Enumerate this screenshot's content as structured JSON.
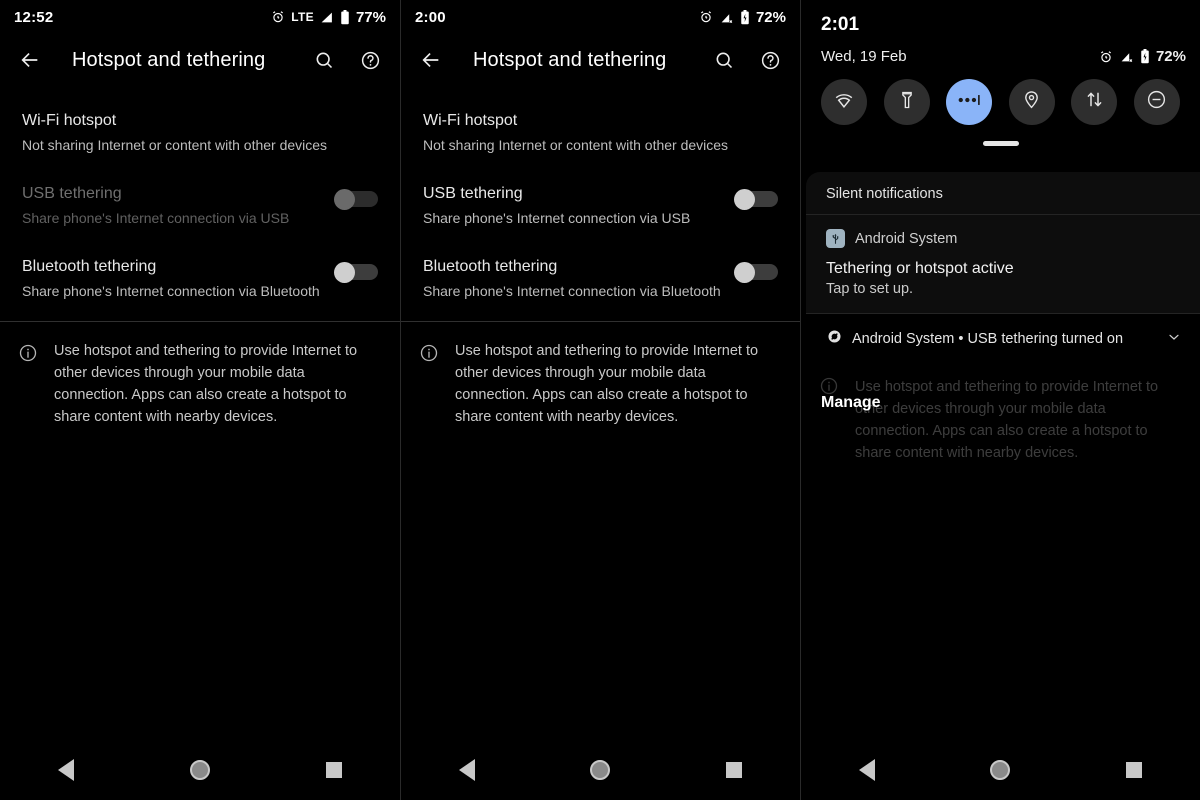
{
  "panel1": {
    "status": {
      "clock": "12:52",
      "network": "LTE",
      "battery": "77%",
      "icons": [
        "alarm-icon",
        "signal-icon",
        "battery-icon"
      ]
    },
    "appbar": {
      "title": "Hotspot and tethering",
      "back": "back-arrow-icon",
      "search": "search-icon",
      "help": "help-icon"
    },
    "rows": [
      {
        "title": "Wi-Fi hotspot",
        "subtitle": "Not sharing Internet or content with other devices",
        "has_switch": false,
        "enabled": true
      },
      {
        "title": "USB tethering",
        "subtitle": "Share phone's Internet connection via USB",
        "has_switch": true,
        "switch_on": false,
        "enabled": false
      },
      {
        "title": "Bluetooth tethering",
        "subtitle": "Share phone's Internet connection via Bluetooth",
        "has_switch": true,
        "switch_on": false,
        "enabled": true
      }
    ],
    "info": {
      "icon": "info-icon",
      "text": "Use hotspot and tethering to provide Internet to other devices through your mobile data connection. Apps can also create a hotspot to share content with nearby devices."
    }
  },
  "panel2": {
    "status": {
      "clock": "2:00",
      "network": "",
      "battery": "72%",
      "icons": [
        "alarm-icon",
        "signal-off-icon",
        "battery-charging-icon"
      ]
    },
    "appbar": {
      "title": "Hotspot and tethering",
      "back": "back-arrow-icon",
      "search": "search-icon",
      "help": "help-icon"
    },
    "rows": [
      {
        "title": "Wi-Fi hotspot",
        "subtitle": "Not sharing Internet or content with other devices",
        "has_switch": false,
        "enabled": true
      },
      {
        "title": "USB tethering",
        "subtitle": "Share phone's Internet connection via USB",
        "has_switch": true,
        "switch_on": false,
        "enabled": true
      },
      {
        "title": "Bluetooth tethering",
        "subtitle": "Share phone's Internet connection via Bluetooth",
        "has_switch": true,
        "switch_on": false,
        "enabled": true
      }
    ],
    "info": {
      "icon": "info-icon",
      "text": "Use hotspot and tethering to provide Internet to other devices through your mobile data connection. Apps can also create a hotspot to share content with nearby devices."
    }
  },
  "panel3": {
    "clock": "2:01",
    "date": "Wed, 19 Feb",
    "battery": "72%",
    "tiles": [
      {
        "name": "wifi-off-icon",
        "active": false
      },
      {
        "name": "flashlight-icon",
        "active": false
      },
      {
        "name": "more-options-icon",
        "active": true
      },
      {
        "name": "location-icon",
        "active": false
      },
      {
        "name": "data-transfer-icon",
        "active": false
      },
      {
        "name": "do-not-disturb-icon",
        "active": false
      }
    ],
    "shade": {
      "header": "Silent notifications",
      "notification": {
        "app": "Android System",
        "app_icon": "usb-icon",
        "title": "Tethering or hotspot active",
        "body": "Tap to set up."
      },
      "collapsed_notification": {
        "icon": "silent-icon",
        "text": "Android System • USB tethering turned on",
        "expand": "chevron-down-icon"
      },
      "manage": "Manage"
    },
    "background_info": "Use hotspot and tethering to provide Internet to other devices through your mobile data connection. Apps can also create a hotspot to share content with nearby devices."
  },
  "navbar": {
    "back": "nav-back-icon",
    "home": "nav-home-icon",
    "recents": "nav-recents-icon"
  }
}
